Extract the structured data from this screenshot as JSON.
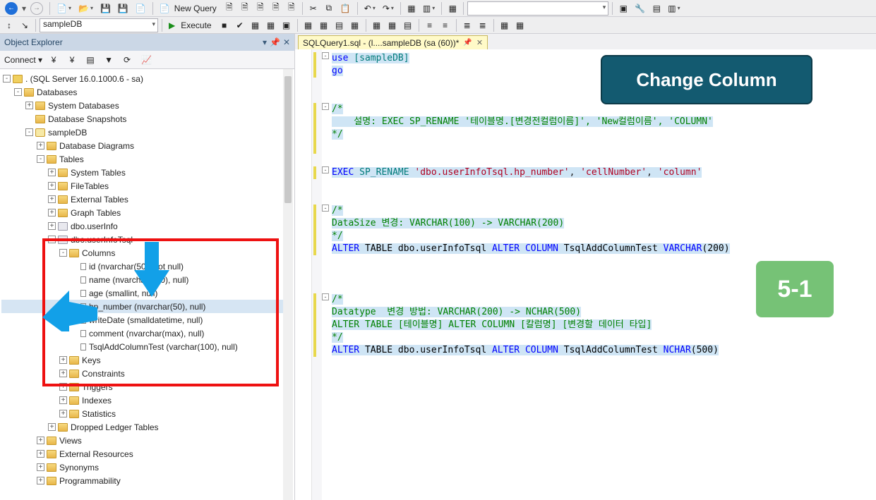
{
  "toolbar1": {
    "new_query": "New Query",
    "combo_long_placeholder": ""
  },
  "toolbar2": {
    "db_combo": "sampleDB",
    "execute": "Execute"
  },
  "explorer": {
    "title": "Object Explorer",
    "connect": "Connect",
    "tree": {
      "server": ". (SQL Server 16.0.1000.6 - sa)",
      "databases": "Databases",
      "sys_db": "System Databases",
      "snapshots": "Database Snapshots",
      "sampledb": "sampleDB",
      "db_diag": "Database Diagrams",
      "tables": "Tables",
      "sys_tables": "System Tables",
      "file_tables": "FileTables",
      "ext_tables": "External Tables",
      "graph_tables": "Graph Tables",
      "userinfo": "dbo.userInfo",
      "userinfotsql": "dbo.userInfoTsql",
      "columns": "Columns",
      "col_id": "id (nvarchar(50), not null)",
      "col_name": "name (nvarchar(500), null)",
      "col_age": "age (smallint, null)",
      "col_hp": "hp_number (nvarchar(50), null)",
      "col_write": "writeDate (smalldatetime, null)",
      "col_comment": "comment (nvarchar(max), null)",
      "col_test": "TsqlAddColumnTest (varchar(100), null)",
      "keys": "Keys",
      "constraints": "Constraints",
      "triggers": "Triggers",
      "indexes": "Indexes",
      "statistics": "Statistics",
      "dropped": "Dropped Ledger Tables",
      "views": "Views",
      "ext_res": "External Resources",
      "synonyms": "Synonyms",
      "program": "Programmability"
    }
  },
  "tab": {
    "label": "SQLQuery1.sql - (l....sampleDB (sa (60))*"
  },
  "code": {
    "l1a": "use",
    "l1b": " [sampleDB]",
    "l2": "go",
    "cmt1_open": "/*",
    "cmt1_body": "    설명: EXEC SP_RENAME '테이블명.[변경전컬럼이름]', 'New컬럼이름', 'COLUMN'",
    "cmt1_close": "*/",
    "exec": "EXEC",
    "sp": " SP_RENAME ",
    "s1": "'dbo.userInfoTsql.hp_number'",
    "c1": ", ",
    "s2": "'cellNumber'",
    "c2": ", ",
    "s3": "'column'",
    "cmt2_open": "/*",
    "cmt2_body": "DataSize 변경: VARCHAR(100) -> VARCHAR(200)",
    "cmt2_close": "*/",
    "a1_alter": "ALTER",
    "a1_rest": " TABLE dbo.userInfoTsql ",
    "a1_alter2": "ALTER",
    "a1_col": " COLUMN",
    "a1_rest2": " TsqlAddColumnTest ",
    "a1_type": "VARCHAR",
    "a1_paren": "(200)",
    "cmt3_open": "/*",
    "cmt3_body1": "Datatype  변경 방법: VARCHAR(200) -> NCHAR(500)",
    "cmt3_body2": "ALTER TABLE [테이블명] ALTER COLUMN [칼럼명] [변경할 데이터 타입]",
    "cmt3_close": "*/",
    "a2_alter": "ALTER",
    "a2_rest": " TABLE dbo.userInfoTsql ",
    "a2_alter2": "ALTER",
    "a2_col": " COLUMN",
    "a2_rest2": " TsqlAddColumnTest ",
    "a2_type": "NCHAR",
    "a2_paren": "(500)"
  },
  "callouts": {
    "title": "Change Column",
    "step": "5-1"
  }
}
